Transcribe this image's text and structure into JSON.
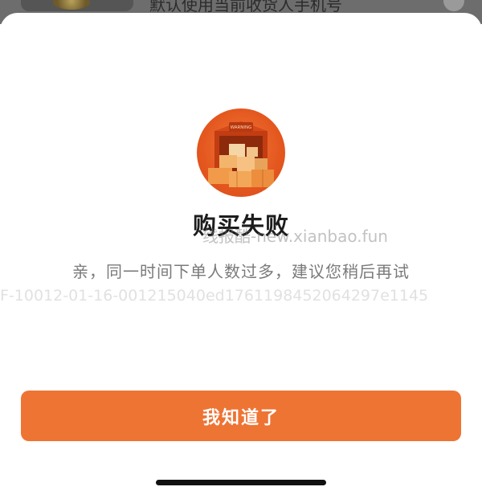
{
  "background": {
    "hint_text": "默认使用当前收货人手机号"
  },
  "dialog": {
    "title": "购买失败",
    "message": "亲，同一时间下单人数过多，建议您稍后再试",
    "trace_id": "F-10012-01-16-001215040ed1761198452064297e1145",
    "hero_sign": "WARNING",
    "confirm_label": "我知道了",
    "watermark": "线报酷-new.xianbao.fun"
  },
  "colors": {
    "accent": "#ee7434",
    "hero": "#e4571f",
    "title": "#1c1c1c",
    "message": "#7a7a7a"
  }
}
